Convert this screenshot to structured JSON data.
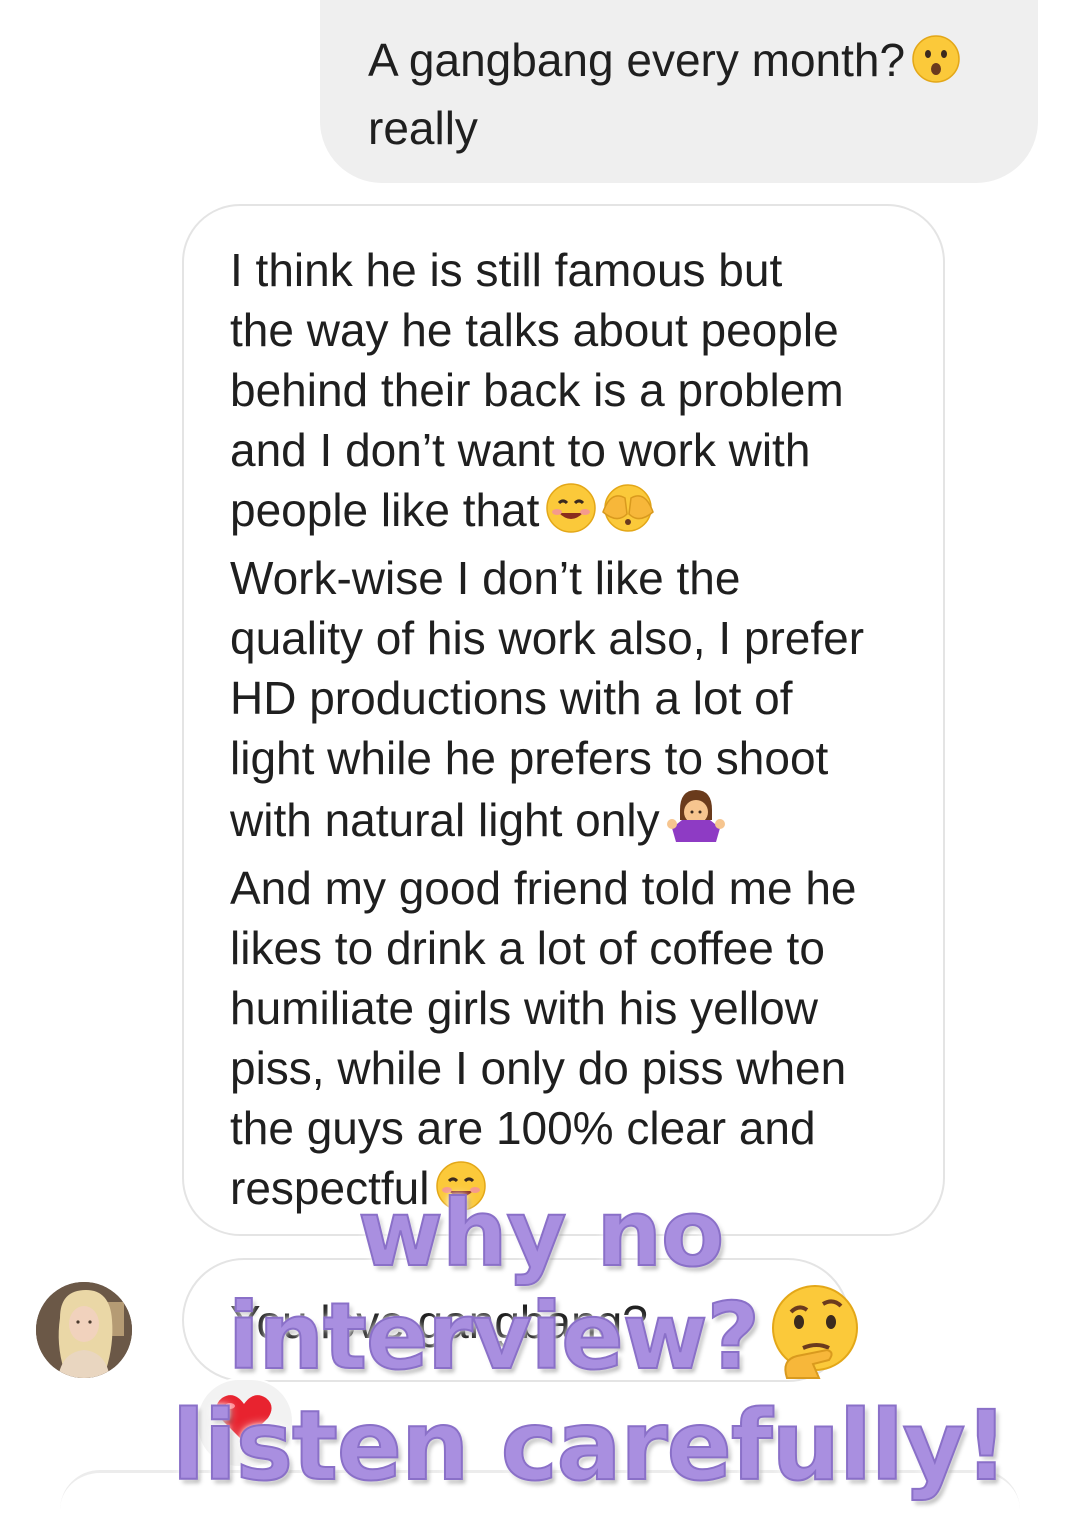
{
  "messages": {
    "sent": {
      "text_line1": "A gangbang every month?",
      "text_line2": "really",
      "emoji": "hushed-face"
    },
    "received": {
      "line1": "I think he is still famous but",
      "line2": "the way he talks about people",
      "line3": "behind their back is a problem",
      "line4": "and I don’t want to work with",
      "line5": "people like that",
      "line6": "Work-wise I don’t like the",
      "line7": "quality of his work also, I prefer",
      "line8": "HD productions with a lot of",
      "line9": "light while he prefers to shoot",
      "line10": "with natural light only",
      "line11": "And my good friend told me he",
      "line12": "likes to drink a lot of coffee to",
      "line13": "humiliate girls with his yellow",
      "line14": "piss, while I only do piss when",
      "line15": "the guys are 100% clear and",
      "line16": "respectful",
      "emojis": [
        "smiling-face-emoji",
        "face-with-hand-over-mouth-emoji",
        "person-shrugging-emoji",
        "smiling-face-emoji"
      ]
    },
    "partial": {
      "text": "You love gangbang?",
      "reaction": "red-heart"
    }
  },
  "overlay": {
    "line1": "why no",
    "line2": "interview?",
    "line3": "listen carefully!",
    "color": "#a98fe0",
    "emoji": "thinking-face"
  },
  "colors": {
    "sent_bubble": "#efefef",
    "received_border": "#e4e4e4",
    "text": "#1f1f1f"
  }
}
